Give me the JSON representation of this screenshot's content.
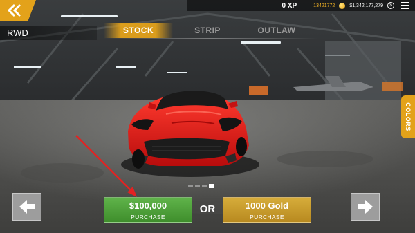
{
  "topbar": {
    "xp": "0 XP",
    "gold": "13421772",
    "cash": "$1,342,177,279",
    "cash_symbol": "$"
  },
  "car": {
    "drivetrain": "RWD",
    "color": "#d81414"
  },
  "tabs": [
    {
      "label": "STOCK",
      "active": true
    },
    {
      "label": "STRIP",
      "active": false
    },
    {
      "label": "OUTLAW",
      "active": false
    }
  ],
  "side_tab": {
    "label": "COLORS"
  },
  "pager": {
    "count": 4,
    "active_index": 3
  },
  "purchase": {
    "cash_price": "$100,000",
    "cash_sub": "PURCHASE",
    "or": "OR",
    "gold_price": "1000 Gold",
    "gold_sub": "PURCHASE"
  },
  "colors": {
    "accent": "#e3a21a",
    "cash_button": "#4fa23a",
    "gold_button": "#c99a2c",
    "pointer": "#e32222"
  },
  "icons": {
    "back": "double-chevron-left-icon",
    "gold": "gold-coin-icon",
    "cash": "dollar-coin-icon",
    "menu": "hamburger-menu-icon",
    "prev": "arrow-left-icon",
    "next": "arrow-right-icon"
  }
}
